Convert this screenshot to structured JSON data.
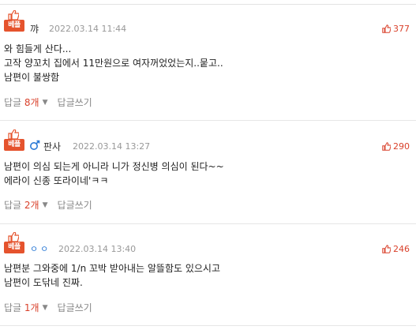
{
  "comments": [
    {
      "badge": "베플",
      "author": "꺄",
      "date": "2022.03.14 11:44",
      "likes": "377",
      "lines": [
        "와 힘들게 산다...",
        "고작 양꼬치 집에서 11만원으로 여자꺼었었는지..뭍고..",
        "남편이 불쌍함"
      ],
      "reply_label": "답글",
      "reply_count": "8개",
      "write_label": "답글쓰기"
    },
    {
      "badge": "베플",
      "author": "판사",
      "date": "2022.03.14 13:27",
      "likes": "290",
      "lines": [
        "남편이 의심 되는게 아니라 니가 정신병 의심이 된다~~",
        "에라이 신종 또라이네'ㅋㅋ"
      ],
      "reply_label": "답글",
      "reply_count": "2개",
      "write_label": "답글쓰기"
    },
    {
      "badge": "베플",
      "author": "ㅇㅇ",
      "date": "2022.03.14 13:40",
      "likes": "246",
      "lines": [
        "남편분 그와중에 1/n 꼬박 받아내는 알뜰함도 있으시고",
        "남편이 도닦네 진짜."
      ],
      "reply_label": "답글",
      "reply_count": "1개",
      "write_label": "답글쓰기"
    }
  ],
  "colors": {
    "accent": "#e5532d",
    "likes": "#d9412b",
    "muted": "#888888"
  },
  "icons": {
    "badge": "thumbs-up-icon",
    "likes": "thumbs-up-icon",
    "gender": "male-icon",
    "caret": "caret-down-icon"
  }
}
